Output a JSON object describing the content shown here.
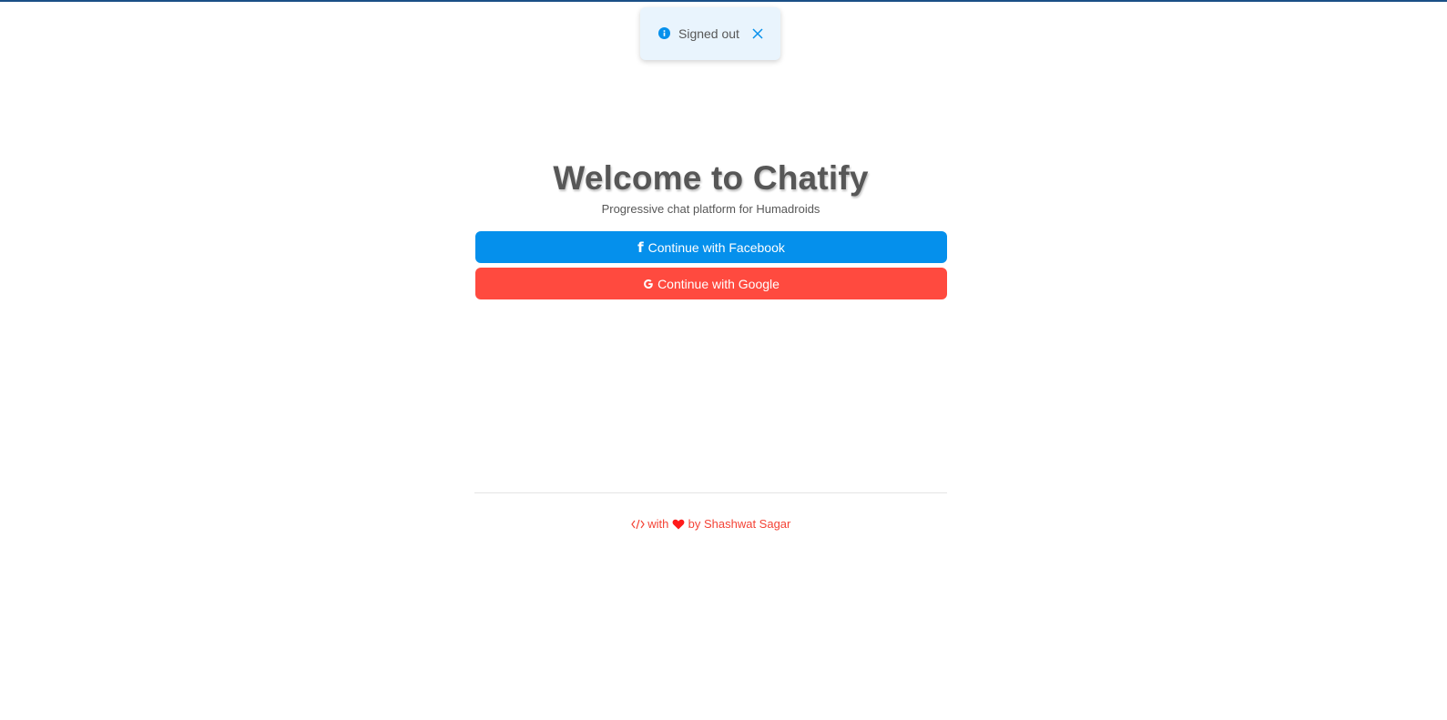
{
  "toast": {
    "icon": "info-icon",
    "message": "Signed out",
    "close_icon": "close-icon",
    "accent_color": "#0590ec"
  },
  "welcome": {
    "title": "Welcome to Chatify",
    "subtitle": "Progressive chat platform for Humadroids"
  },
  "buttons": {
    "facebook": {
      "icon": "facebook-icon",
      "label": "Continue with Facebook",
      "color": "#0590ec"
    },
    "google": {
      "icon": "google-icon",
      "label": "Continue with Google",
      "color": "#ff4a3f"
    }
  },
  "footer": {
    "code_icon": "code-icon",
    "with_text": "with",
    "heart_icon": "heart-icon",
    "by_text": "by Shashwat Sagar",
    "color": "#f44336"
  },
  "colors": {
    "top_bar": "#1a4f86",
    "text": "#575757"
  }
}
